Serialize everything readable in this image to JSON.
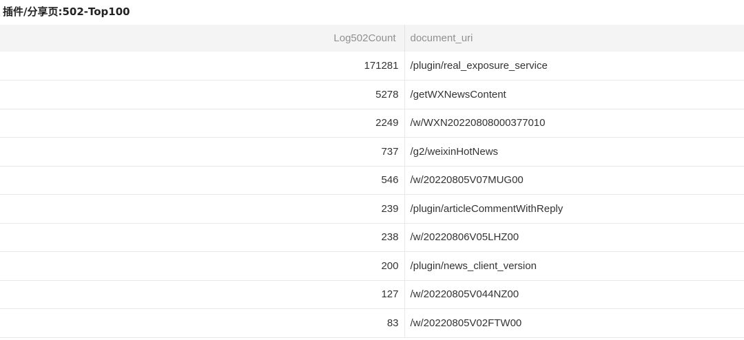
{
  "panel": {
    "title": "插件/分享页:502-Top100"
  },
  "table": {
    "columns": [
      "Log502Count",
      "document_uri"
    ],
    "rows": [
      {
        "count": "171281",
        "uri": "/plugin/real_exposure_service"
      },
      {
        "count": "5278",
        "uri": "/getWXNewsContent"
      },
      {
        "count": "2249",
        "uri": "/w/WXN20220808000377010"
      },
      {
        "count": "737",
        "uri": "/g2/weixinHotNews"
      },
      {
        "count": "546",
        "uri": "/w/20220805V07MUG00"
      },
      {
        "count": "239",
        "uri": "/plugin/articleCommentWithReply"
      },
      {
        "count": "238",
        "uri": "/w/20220806V05LHZ00"
      },
      {
        "count": "200",
        "uri": "/plugin/news_client_version"
      },
      {
        "count": "127",
        "uri": "/w/20220805V044NZ00"
      },
      {
        "count": "83",
        "uri": "/w/20220805V02FTW00"
      }
    ]
  }
}
